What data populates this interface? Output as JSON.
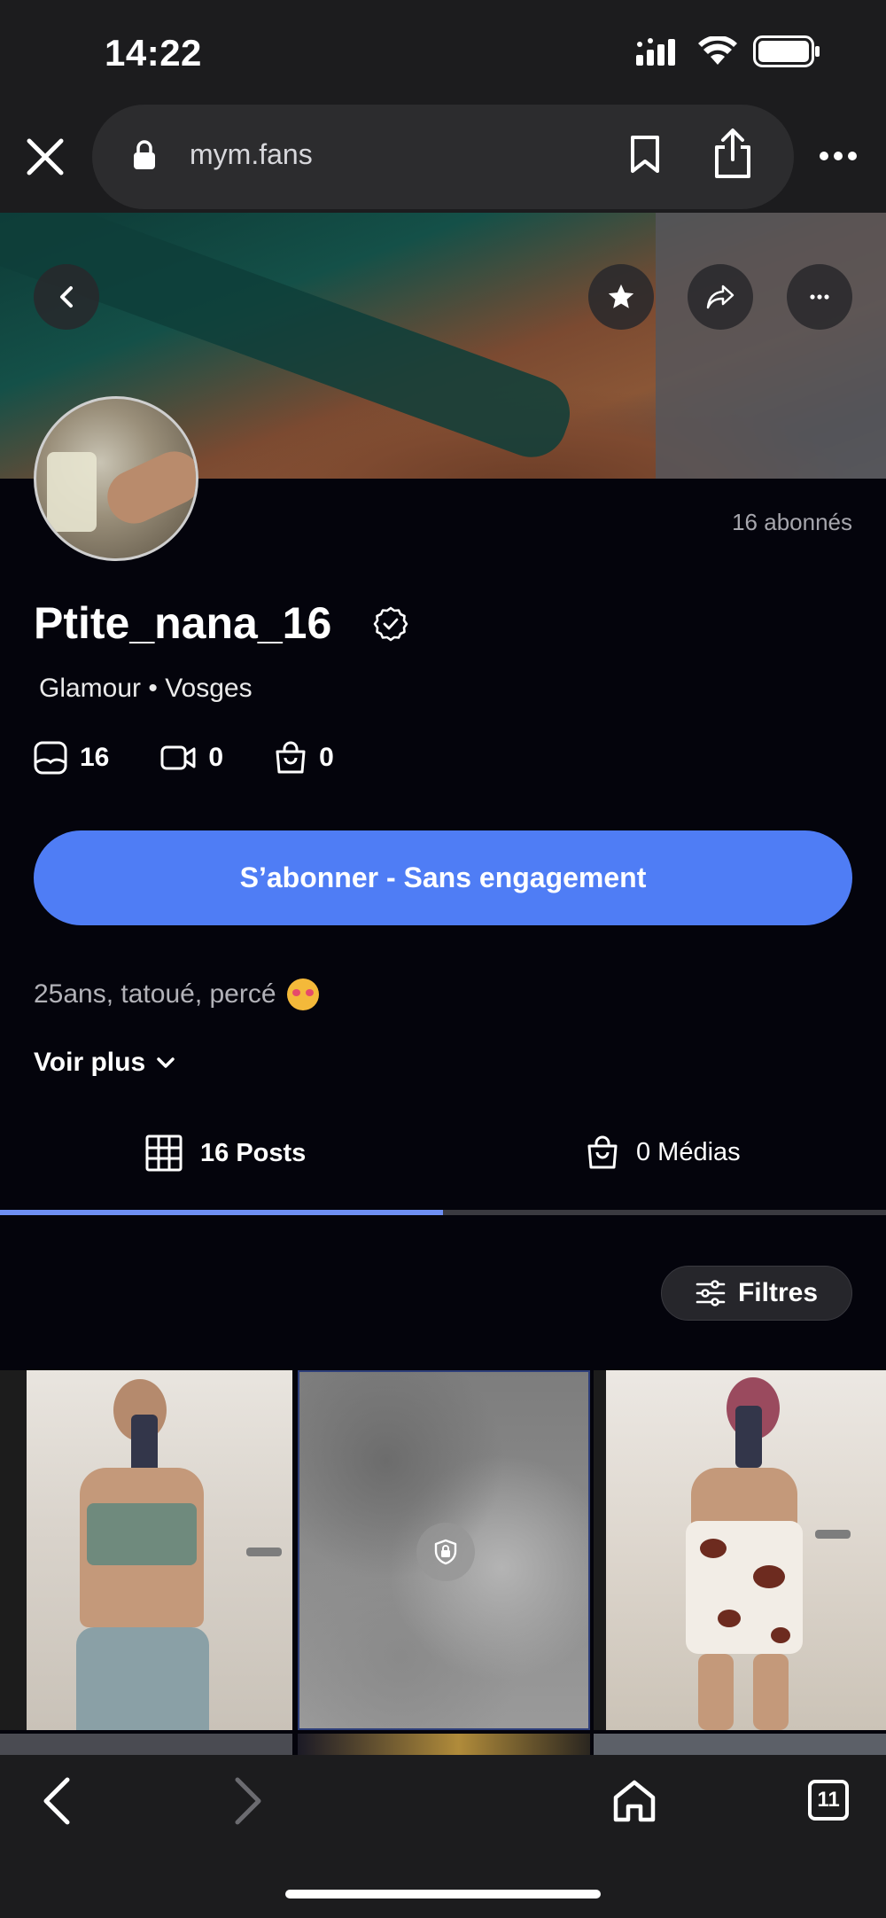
{
  "status_bar": {
    "time": "14:22"
  },
  "browser": {
    "url": "mym.fans",
    "open_tabs": "11"
  },
  "profile": {
    "subscribers": "16 abonnés",
    "username": "Ptite_nana_16",
    "category": "Glamour • Vosges",
    "stats": {
      "photos": "16",
      "videos": "0",
      "shop": "0"
    },
    "subscribe_label": "S’abonner - Sans engagement",
    "bio": "25ans, tatoué, percé",
    "see_more_label": "Voir plus"
  },
  "tabs": [
    {
      "label": "16 Posts",
      "icon": "grid-icon",
      "active": true
    },
    {
      "label": "0 Médias",
      "icon": "bag-icon",
      "active": false
    }
  ],
  "filters_label": "Filtres",
  "colors": {
    "accent": "#4f7df5",
    "tab_indicator": "#6e8ff3",
    "background": "#04040c",
    "chrome": "#1c1c1e"
  }
}
